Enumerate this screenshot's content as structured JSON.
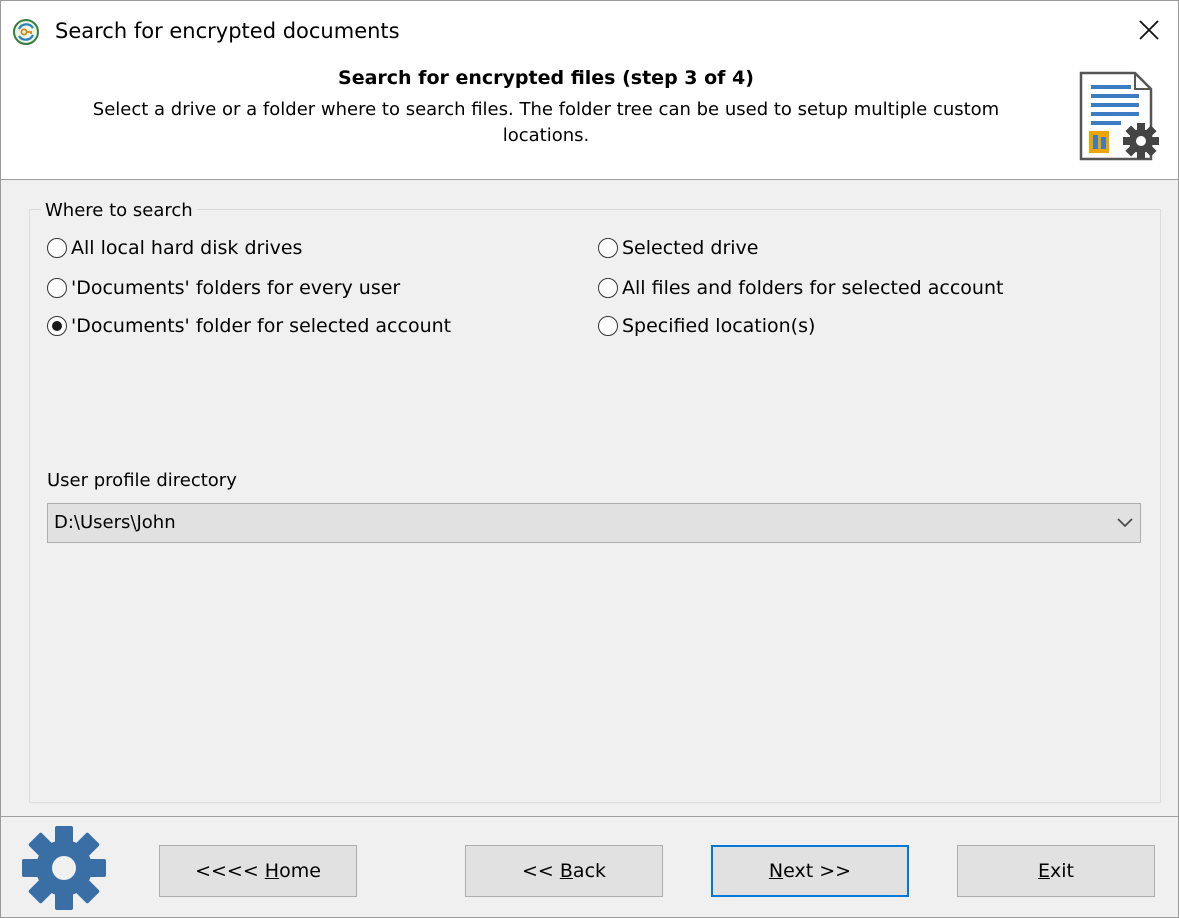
{
  "window": {
    "title": "Search for encrypted documents",
    "app_icon": "refresh-key-icon",
    "close_icon": "close-icon"
  },
  "header": {
    "title": "Search for encrypted files (step 3 of 4)",
    "description": "Select a drive or a folder where to search files. The folder tree can be used to setup multiple custom locations.",
    "icon": "document-key-gear-icon"
  },
  "where_to_search": {
    "label": "Where to search",
    "options": [
      {
        "label": "All local hard disk drives",
        "checked": false
      },
      {
        "label": "'Documents' folders for every user",
        "checked": false
      },
      {
        "label": "'Documents' folder for selected account",
        "checked": true
      },
      {
        "label": "Selected drive",
        "checked": false
      },
      {
        "label": "All files and folders for selected account",
        "checked": false
      },
      {
        "label": "Specified location(s)",
        "checked": false
      }
    ]
  },
  "user_profile": {
    "label": "User profile directory",
    "value": "D:\\Users\\John"
  },
  "buttons": {
    "home_prefix": "<<<< ",
    "home_accel": "H",
    "home_rest": "ome",
    "back_prefix": "<< ",
    "back_accel": "B",
    "back_rest": "ack",
    "next_accel": "N",
    "next_rest": "ext >>",
    "exit_accel": "E",
    "exit_rest": "xit"
  },
  "colors": {
    "accent": "#0078d7",
    "gear": "#3a6fa5",
    "background": "#f0f0f0"
  }
}
